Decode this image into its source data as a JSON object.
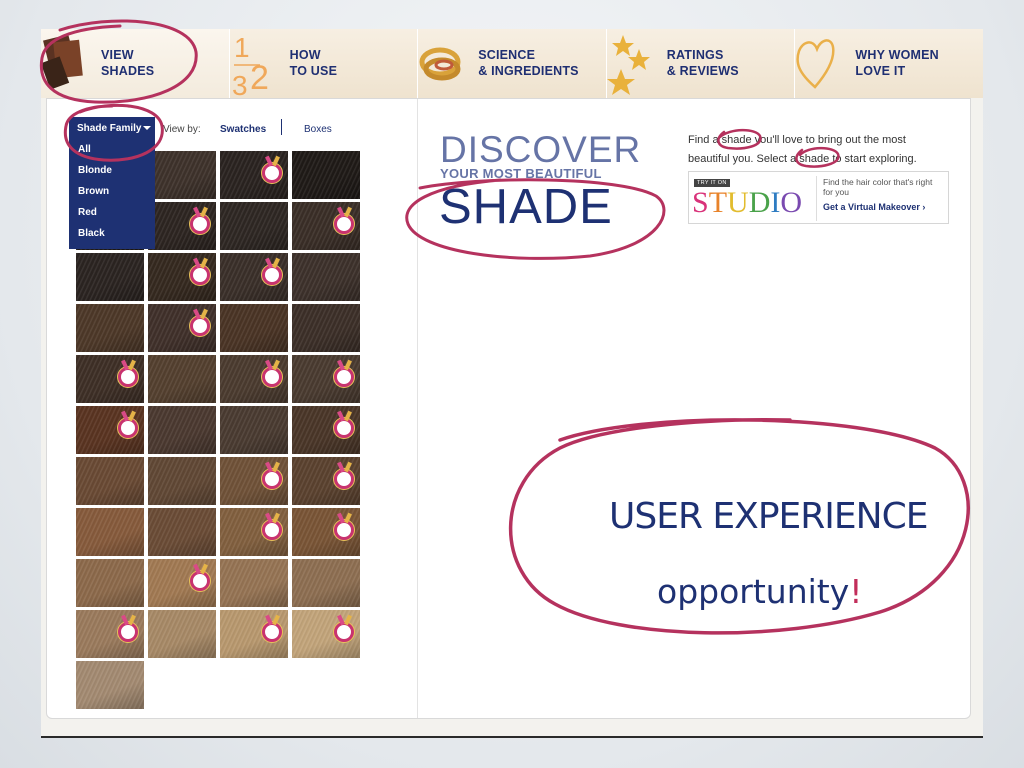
{
  "nav": {
    "items": [
      {
        "label": "VIEW\nSHADES",
        "icon": "hair-swatch-icon"
      },
      {
        "label": "HOW\nTO USE",
        "icon": "steps-123-icon"
      },
      {
        "label": "SCIENCE\n& INGREDIENTS",
        "icon": "rings-icon"
      },
      {
        "label": "RATINGS\n& REVIEWS",
        "icon": "stars-icon"
      },
      {
        "label": "WHY WOMEN\nLOVE IT",
        "icon": "heart-icon"
      }
    ],
    "steps_digits": [
      "1",
      "2",
      "3"
    ]
  },
  "toolbar": {
    "shade_family_label": "Shade Family",
    "dropdown_options": [
      "All",
      "Blonde",
      "Brown",
      "Red",
      "Black"
    ],
    "view_by_label": "View by:",
    "view_swatches": "Swatches",
    "view_boxes": "Boxes"
  },
  "swatches": {
    "rows": [
      [
        {
          "c": "#1a1512",
          "m": false
        },
        {
          "c": "#3e322b",
          "m": false
        },
        {
          "c": "#2a2320",
          "m": true
        },
        {
          "c": "#1f1a17",
          "m": false
        }
      ],
      [
        {
          "c": "#211b18",
          "m": false
        },
        {
          "c": "#2d2521",
          "m": true
        },
        {
          "c": "#2e2723",
          "m": false
        },
        {
          "c": "#3a2e27",
          "m": true
        }
      ],
      [
        {
          "c": "#2b2421",
          "m": false
        },
        {
          "c": "#35291f",
          "m": true
        },
        {
          "c": "#3a2f29",
          "m": true
        },
        {
          "c": "#3d312b",
          "m": false
        }
      ],
      [
        {
          "c": "#4d3828",
          "m": false
        },
        {
          "c": "#40302a",
          "m": true
        },
        {
          "c": "#4a3425",
          "m": false
        },
        {
          "c": "#3c2f28",
          "m": false
        }
      ],
      [
        {
          "c": "#3e2f26",
          "m": true
        },
        {
          "c": "#54402f",
          "m": false
        },
        {
          "c": "#4b3b2f",
          "m": true
        },
        {
          "c": "#4a3b30",
          "m": true
        }
      ],
      [
        {
          "c": "#5a3421",
          "m": true
        },
        {
          "c": "#4b3930",
          "m": false
        },
        {
          "c": "#4a3b31",
          "m": false
        },
        {
          "c": "#4a3628",
          "m": true
        }
      ],
      [
        {
          "c": "#6a4a34",
          "m": false
        },
        {
          "c": "#614835",
          "m": false
        },
        {
          "c": "#705238",
          "m": true
        },
        {
          "c": "#5b422f",
          "m": true
        }
      ],
      [
        {
          "c": "#875b3c",
          "m": false
        },
        {
          "c": "#6b4c36",
          "m": false
        },
        {
          "c": "#82603f",
          "m": true
        },
        {
          "c": "#7a5536",
          "m": true
        }
      ],
      [
        {
          "c": "#8d6a4b",
          "m": false
        },
        {
          "c": "#a27a53",
          "m": true
        },
        {
          "c": "#967454",
          "m": false
        },
        {
          "c": "#8e6f52",
          "m": false
        }
      ],
      [
        {
          "c": "#9b7b5d",
          "m": true
        },
        {
          "c": "#a88a67",
          "m": false
        },
        {
          "c": "#b9996f",
          "m": true
        },
        {
          "c": "#c3a57b",
          "m": true
        }
      ],
      [
        {
          "c": "#a48b72",
          "m": false
        }
      ]
    ]
  },
  "hero": {
    "title_top": "DISCOVER",
    "title_sub": "YOUR MOST BEAUTIFUL",
    "title_main": "SHADE"
  },
  "find": {
    "text": "Find a shade you'll love to bring out the most beautiful you. Select a shade to start exploring."
  },
  "studio": {
    "tag": "TRY IT ON",
    "word": "STUDIO",
    "desc": "Find the hair color that's right for you",
    "cta": "Get a Virtual Makeover ›"
  },
  "callout": {
    "line1": "USER EXPERIENCE",
    "line2": "opportunity",
    "bang": "!"
  },
  "colors": {
    "brand_navy": "#1e3173",
    "annotation_magenta": "#b5325e",
    "nav_bg": "#efe3cf"
  }
}
